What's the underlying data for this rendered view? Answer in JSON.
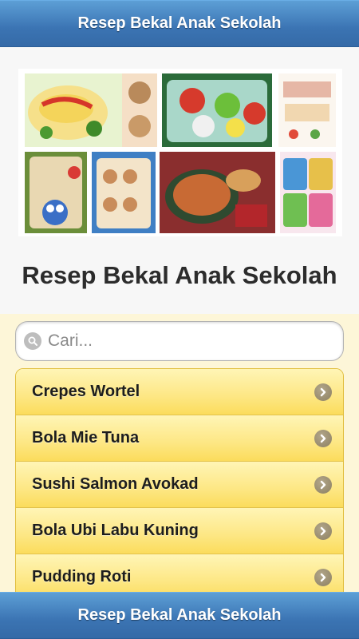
{
  "header": {
    "title": "Resep Bekal Anak Sekolah"
  },
  "hero": {
    "title": "Resep Bekal Anak Sekolah"
  },
  "search": {
    "placeholder": "Cari..."
  },
  "recipes": [
    {
      "label": "Crepes Wortel"
    },
    {
      "label": "Bola Mie Tuna"
    },
    {
      "label": "Sushi Salmon Avokad"
    },
    {
      "label": "Bola Ubi Labu Kuning"
    },
    {
      "label": "Pudding Roti"
    }
  ],
  "footer": {
    "title": "Resep Bekal Anak Sekolah"
  },
  "colors": {
    "bar_blue": "#3b74b3",
    "list_yellow": "#fde784",
    "chevron": "#8b7f62"
  },
  "icons": {
    "search": "search-icon",
    "chevron": "chevron-right-icon"
  }
}
